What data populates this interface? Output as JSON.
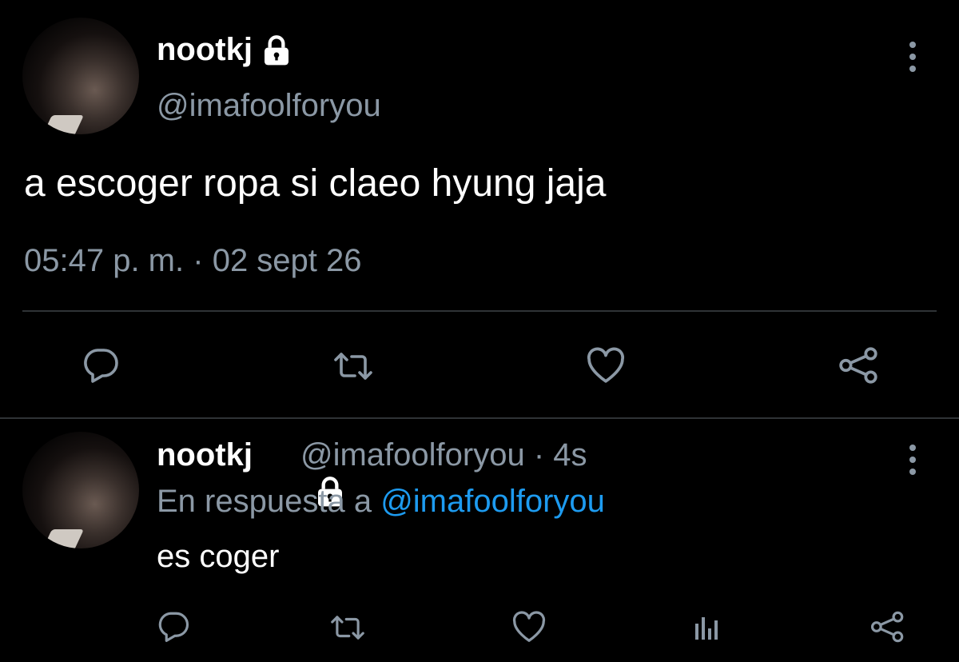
{
  "main_tweet": {
    "display_name": "nootkj",
    "handle": "@imafoolforyou",
    "text": "a escoger ropa si claeo hyung jaja",
    "time": "05:47 p. m.",
    "separator": "·",
    "date": "02 sept 26",
    "icons": {
      "protected": "lock-icon",
      "more": "more-vertical-icon",
      "reply": "reply-bubble-icon",
      "retweet": "retweet-icon",
      "like": "heart-icon",
      "share": "share-icon"
    }
  },
  "reply_tweet": {
    "display_name": "nootkj",
    "handle": "@imafoolforyou",
    "separator": "·",
    "time": "4s",
    "reply_to_prefix": "En respuesta a",
    "reply_to_handle": "@imafoolforyou",
    "text": "es coger",
    "icons": {
      "protected": "lock-icon",
      "more": "more-vertical-icon",
      "reply": "reply-bubble-icon",
      "retweet": "retweet-icon",
      "like": "heart-icon",
      "analytics": "analytics-bars-icon",
      "share": "share-icon"
    }
  },
  "colors": {
    "background": "#000000",
    "primary_text": "#ffffff",
    "secondary_text": "#8b98a5",
    "link": "#1d9bf0",
    "divider": "#2f3336"
  }
}
